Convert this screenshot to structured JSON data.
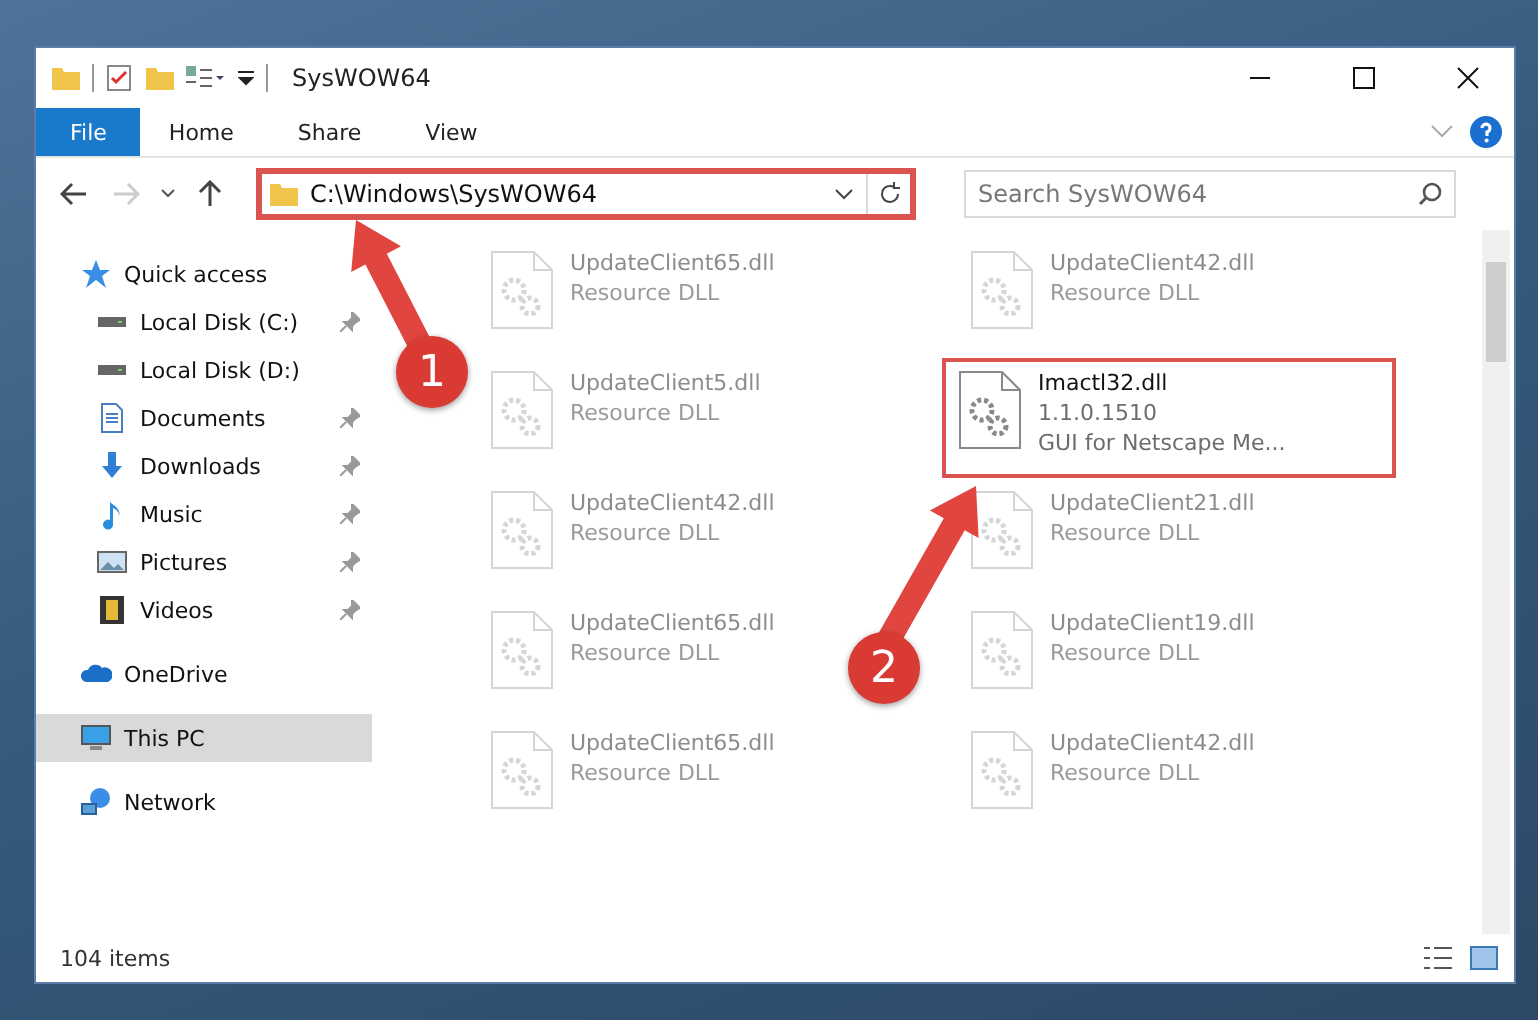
{
  "window": {
    "title": "SysWOW64"
  },
  "ribbon_tabs": [
    {
      "label": "File",
      "selected": true
    },
    {
      "label": "Home",
      "selected": false
    },
    {
      "label": "Share",
      "selected": false
    },
    {
      "label": "View",
      "selected": false
    }
  ],
  "address_bar": {
    "path": "C:\\Windows\\SysWOW64",
    "highlighted": true
  },
  "search": {
    "placeholder": "Search SysWOW64"
  },
  "sidebar": {
    "items": [
      {
        "label": "Quick access",
        "kind": "star",
        "selected": false,
        "children": [
          {
            "label": "Local Disk (C:)",
            "kind": "drive",
            "selected": false,
            "pinned": true
          },
          {
            "label": "Local Disk (D:)",
            "kind": "drive",
            "selected": false,
            "pinned": false
          },
          {
            "label": "Documents",
            "kind": "document",
            "selected": false,
            "pinned": true
          },
          {
            "label": "Downloads",
            "kind": "download",
            "selected": false,
            "pinned": true
          },
          {
            "label": "Music",
            "kind": "music",
            "selected": false,
            "pinned": true
          },
          {
            "label": "Pictures",
            "kind": "pictures",
            "selected": false,
            "pinned": true
          },
          {
            "label": "Videos",
            "kind": "videos",
            "selected": false,
            "pinned": true
          }
        ]
      },
      {
        "label": "OneDrive",
        "kind": "cloud",
        "selected": false
      },
      {
        "label": "This PC",
        "kind": "computer",
        "selected": true
      },
      {
        "label": "Network",
        "kind": "network",
        "selected": false
      }
    ]
  },
  "files": [
    {
      "name": "UpdateClient65.dll",
      "details": [
        "Resource DLL"
      ],
      "blurred": true,
      "highlighted": false
    },
    {
      "name": "UpdateClient42.dll",
      "details": [
        "Resource DLL"
      ],
      "blurred": true,
      "highlighted": false
    },
    {
      "name": "UpdateClient5.dll",
      "details": [
        "Resource DLL"
      ],
      "blurred": true,
      "highlighted": false
    },
    {
      "name": "Imactl32.dll",
      "details": [
        "1.1.0.1510",
        "GUI for Netscape Me..."
      ],
      "blurred": false,
      "highlighted": true
    },
    {
      "name": "UpdateClient42.dll",
      "details": [
        "Resource DLL"
      ],
      "blurred": true,
      "highlighted": false
    },
    {
      "name": "UpdateClient21.dll",
      "details": [
        "Resource DLL"
      ],
      "blurred": true,
      "highlighted": false
    },
    {
      "name": "UpdateClient65.dll",
      "details": [
        "Resource DLL"
      ],
      "blurred": true,
      "highlighted": false
    },
    {
      "name": "UpdateClient19.dll",
      "details": [
        "Resource DLL"
      ],
      "blurred": true,
      "highlighted": false
    },
    {
      "name": "UpdateClient65.dll",
      "details": [
        "Resource DLL"
      ],
      "blurred": true,
      "highlighted": false
    },
    {
      "name": "UpdateClient42.dll",
      "details": [
        "Resource DLL"
      ],
      "blurred": true,
      "highlighted": false
    }
  ],
  "status_bar": {
    "item_count": "104 items"
  },
  "annotations": [
    {
      "label": "1"
    },
    {
      "label": "2"
    }
  ]
}
